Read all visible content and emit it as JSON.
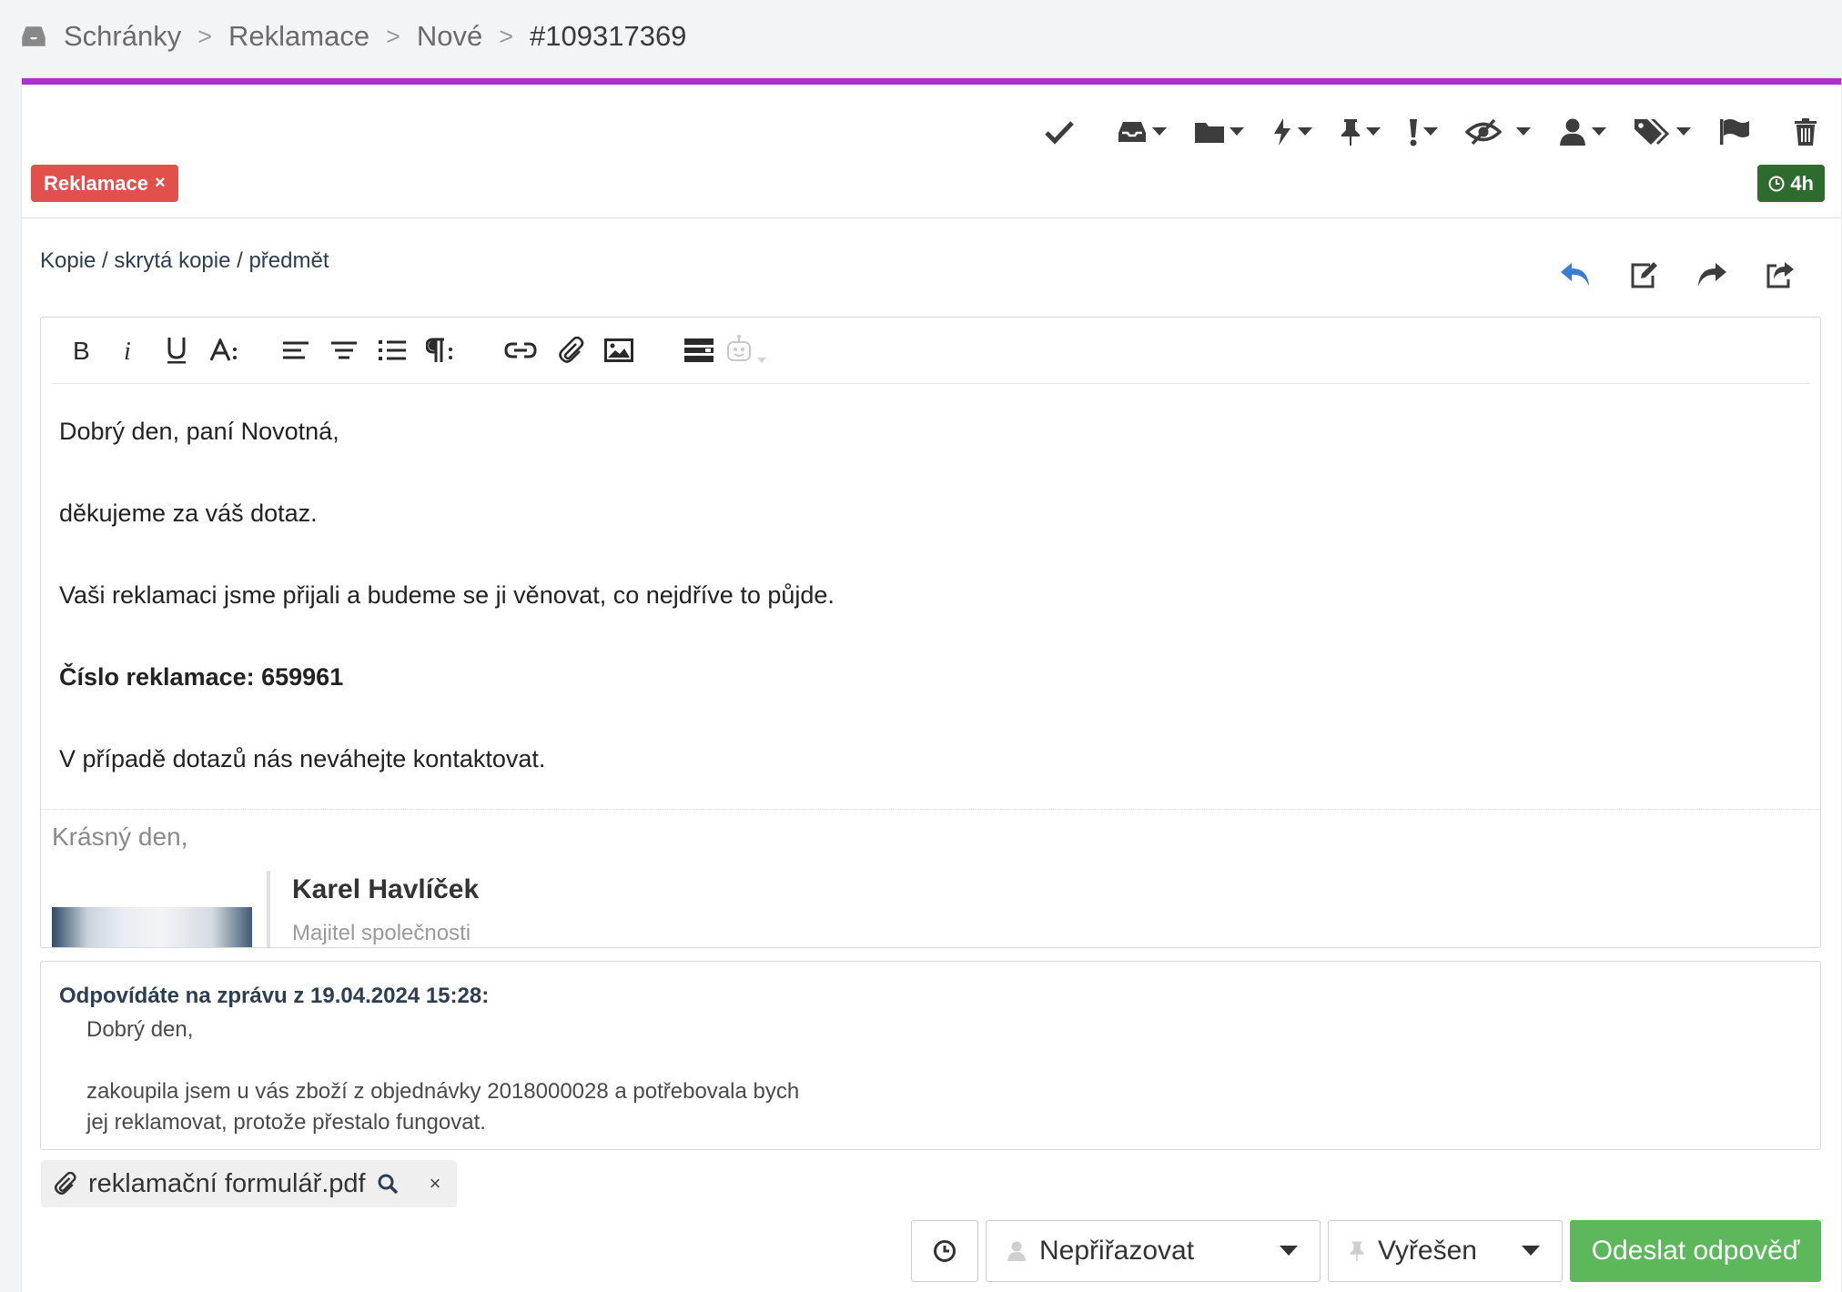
{
  "breadcrumb": {
    "icon": "inbox-icon",
    "items": [
      "Schránky",
      "Reklamace",
      "Nové",
      "#109317369"
    ],
    "separator": ">"
  },
  "accent_color": "#b02fd3",
  "toolbar": {
    "icons": [
      "check-icon",
      "inbox-icon",
      "folder-icon",
      "bolt-icon",
      "pin-icon",
      "exclamation-icon",
      "eye-slash-icon",
      "user-icon",
      "tags-icon",
      "flag-icon",
      "trash-icon"
    ]
  },
  "tags": [
    {
      "label": "Reklamace",
      "remove": "×",
      "color": "#e2504b"
    }
  ],
  "time_badge": {
    "label": "4h",
    "color": "#2e6b2f"
  },
  "compose": {
    "cc_link": "Kopie / skrytá kopie / předmět",
    "reply_actions": [
      "reply-icon",
      "edit-icon",
      "forward-icon",
      "share-icon"
    ]
  },
  "editor": {
    "tools": [
      "bold-icon",
      "italic-icon",
      "underline-icon",
      "font-size-icon",
      "align-left-icon",
      "align-center-icon",
      "ordered-list-icon",
      "paragraph-icon",
      "link-icon",
      "attachment-icon",
      "image-icon",
      "template-icon",
      "ai-assistant-icon"
    ],
    "body": [
      "Dobrý den, paní Novotná,",
      "děkujeme za váš dotaz.",
      "Vaši reklamaci jsme přijali a budeme se ji věnovat, co nejdříve to půjde.",
      "Číslo reklamace: 659961",
      "V případě dotazů nás neváhejte kontaktovat."
    ],
    "signature": {
      "greeting": "Krásný den,",
      "name": "Karel Havlíček",
      "role": "Majitel společnosti"
    }
  },
  "quoted": {
    "header": "Odpovídáte na zprávu z 19.04.2024 15:28:",
    "lines": [
      "Dobrý den,",
      "",
      "zakoupila jsem u vás zboží z objednávky 2018000028 a potřebovala bych",
      "jej reklamovat, protože přestalo fungovat."
    ]
  },
  "attachment": {
    "filename": "reklamační formulář.pdf",
    "remove": "×"
  },
  "footer": {
    "assign_label": "Nepřiřazovat",
    "state_label": "Vyřešen",
    "send_label": "Odeslat odpověď",
    "send_color": "#5db85c"
  }
}
